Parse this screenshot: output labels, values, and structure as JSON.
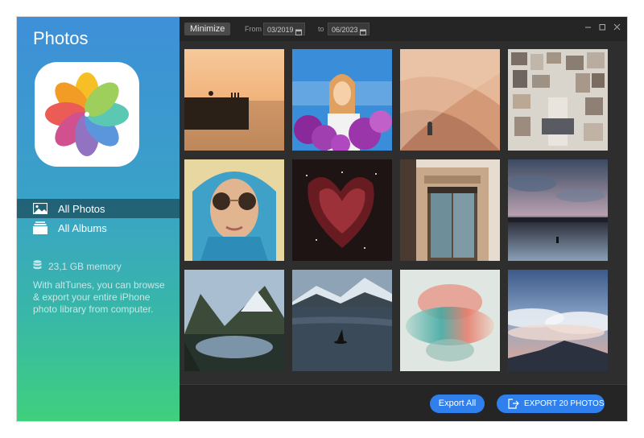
{
  "sidebar": {
    "title": "Photos",
    "nav": [
      {
        "label": "All Photos",
        "icon": "image-icon",
        "active": true
      },
      {
        "label": "All Albums",
        "icon": "album-icon",
        "active": false
      }
    ],
    "memory": "23,1 GB memory",
    "description": "With altTunes, you can browse & export your entire iPhone photo library from computer."
  },
  "toolbar": {
    "minimize_label": "Minimize",
    "from_label": "From",
    "from_date": "03/2019",
    "to_label": "to",
    "to_date": "06/2023"
  },
  "photos": [
    {
      "name": "sunset-pier"
    },
    {
      "name": "woman-purple-flowers"
    },
    {
      "name": "desert-dunes"
    },
    {
      "name": "wall-collage"
    },
    {
      "name": "woman-blue-scarf"
    },
    {
      "name": "red-nebula"
    },
    {
      "name": "old-doorway"
    },
    {
      "name": "twilight-lake"
    },
    {
      "name": "mountain-lake-reflection"
    },
    {
      "name": "orca-fjord"
    },
    {
      "name": "abstract-blur"
    },
    {
      "name": "sunset-clouds-mountain"
    }
  ],
  "footer": {
    "export_all_label": "Export All",
    "export_label": "EXPORT 20 PHOTOS"
  },
  "colors": {
    "accent": "#2f80ec",
    "main_bg": "#2e2e2e",
    "bar_bg": "#252526"
  }
}
